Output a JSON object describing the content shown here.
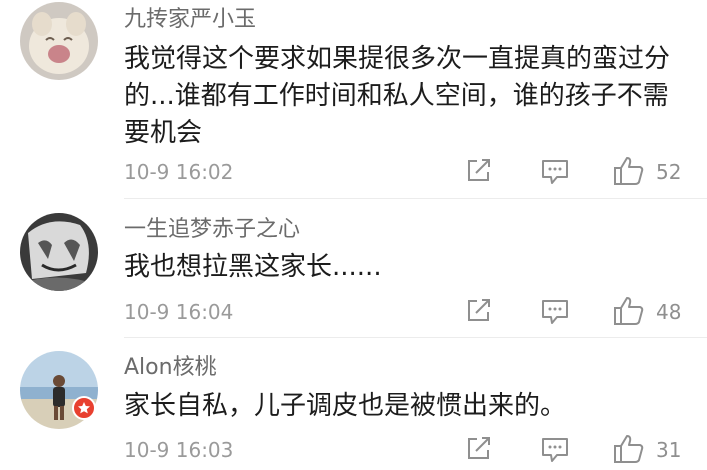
{
  "comments": [
    {
      "username": "九抟家严小玉",
      "text": "我觉得这个要求如果提很多次一直提真的蛮过分的...谁都有工作时间和私人空间，谁的孩子不需要机会",
      "time": "10-9 16:02",
      "likes": "52"
    },
    {
      "username": "一生追梦赤子之心",
      "text": "我也想拉黑这家长......",
      "time": "10-9 16:04",
      "likes": "48"
    },
    {
      "username": "Alon核桃",
      "text": "家长自私，儿子调皮也是被惯出来的。",
      "time": "10-9 16:03",
      "likes": "31"
    }
  ],
  "icons": {
    "share": "share-icon",
    "reply": "comment-icon",
    "like": "thumbs-up-icon"
  },
  "colors": {
    "text": "#1c1c1c",
    "username": "#6b6b6b",
    "meta": "#9a9a9a",
    "badge": "#e8402f"
  }
}
